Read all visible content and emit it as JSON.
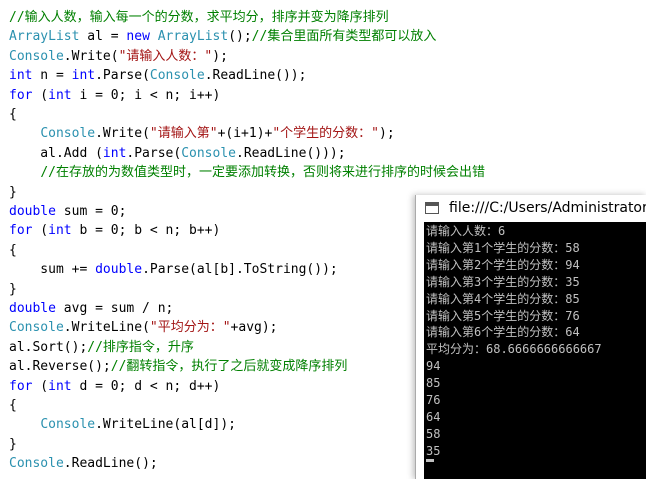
{
  "editor": {
    "lines": [
      [
        {
          "t": "cmt",
          "s": "//输入人数，输入每一个的分数，求平均分，排序并变为降序排列"
        }
      ],
      [
        {
          "t": "type",
          "s": "ArrayList"
        },
        {
          "t": "txt",
          "s": " al = "
        },
        {
          "t": "kw",
          "s": "new"
        },
        {
          "t": "txt",
          "s": " "
        },
        {
          "t": "type",
          "s": "ArrayList"
        },
        {
          "t": "txt",
          "s": "();"
        },
        {
          "t": "cmt",
          "s": "//集合里面所有类型都可以放入"
        }
      ],
      [
        {
          "t": "type",
          "s": "Console"
        },
        {
          "t": "txt",
          "s": ".Write("
        },
        {
          "t": "str",
          "s": "\"请输入人数：\""
        },
        {
          "t": "txt",
          "s": ");"
        }
      ],
      [
        {
          "t": "kw",
          "s": "int"
        },
        {
          "t": "txt",
          "s": " n = "
        },
        {
          "t": "kw",
          "s": "int"
        },
        {
          "t": "txt",
          "s": ".Parse("
        },
        {
          "t": "type",
          "s": "Console"
        },
        {
          "t": "txt",
          "s": ".ReadLine());"
        }
      ],
      [
        {
          "t": "kw",
          "s": "for"
        },
        {
          "t": "txt",
          "s": " ("
        },
        {
          "t": "kw",
          "s": "int"
        },
        {
          "t": "txt",
          "s": " i = 0; i < n; i++)"
        }
      ],
      [
        {
          "t": "txt",
          "s": "{"
        }
      ],
      [
        {
          "t": "txt",
          "s": "    "
        },
        {
          "t": "type",
          "s": "Console"
        },
        {
          "t": "txt",
          "s": ".Write("
        },
        {
          "t": "str",
          "s": "\"请输入第\""
        },
        {
          "t": "txt",
          "s": "+(i+1)+"
        },
        {
          "t": "str",
          "s": "\"个学生的分数：\""
        },
        {
          "t": "txt",
          "s": ");"
        }
      ],
      [
        {
          "t": "txt",
          "s": "    al.Add ("
        },
        {
          "t": "kw",
          "s": "int"
        },
        {
          "t": "txt",
          "s": ".Parse("
        },
        {
          "t": "type",
          "s": "Console"
        },
        {
          "t": "txt",
          "s": ".ReadLine()));"
        }
      ],
      [
        {
          "t": "txt",
          "s": "    "
        },
        {
          "t": "cmt",
          "s": "//在存放的为数值类型时，一定要添加转换，否则将来进行排序的时候会出错"
        }
      ],
      [
        {
          "t": "txt",
          "s": "}"
        }
      ],
      [
        {
          "t": "kw",
          "s": "double"
        },
        {
          "t": "txt",
          "s": " sum = 0;"
        }
      ],
      [
        {
          "t": "kw",
          "s": "for"
        },
        {
          "t": "txt",
          "s": " ("
        },
        {
          "t": "kw",
          "s": "int"
        },
        {
          "t": "txt",
          "s": " b = 0; b < n; b++)"
        }
      ],
      [
        {
          "t": "txt",
          "s": "{"
        }
      ],
      [
        {
          "t": "txt",
          "s": "    sum += "
        },
        {
          "t": "kw",
          "s": "double"
        },
        {
          "t": "txt",
          "s": ".Parse(al[b].ToString());"
        }
      ],
      [
        {
          "t": "txt",
          "s": "}"
        }
      ],
      [
        {
          "t": "kw",
          "s": "double"
        },
        {
          "t": "txt",
          "s": " avg = sum / n;"
        }
      ],
      [
        {
          "t": "type",
          "s": "Console"
        },
        {
          "t": "txt",
          "s": ".WriteLine("
        },
        {
          "t": "str",
          "s": "\"平均分为：\""
        },
        {
          "t": "txt",
          "s": "+avg);"
        }
      ],
      [
        {
          "t": "txt",
          "s": "al.Sort();"
        },
        {
          "t": "cmt",
          "s": "//排序指令，升序"
        }
      ],
      [
        {
          "t": "txt",
          "s": "al.Reverse();"
        },
        {
          "t": "cmt",
          "s": "//翻转指令，执行了之后就变成降序排列"
        }
      ],
      [
        {
          "t": "kw",
          "s": "for"
        },
        {
          "t": "txt",
          "s": " ("
        },
        {
          "t": "kw",
          "s": "int"
        },
        {
          "t": "txt",
          "s": " d = 0; d < n; d++)"
        }
      ],
      [
        {
          "t": "txt",
          "s": "{"
        }
      ],
      [
        {
          "t": "txt",
          "s": "    "
        },
        {
          "t": "type",
          "s": "Console"
        },
        {
          "t": "txt",
          "s": ".WriteLine(al[d]);"
        }
      ],
      [
        {
          "t": "txt",
          "s": "}"
        }
      ],
      [
        {
          "t": "type",
          "s": "Console"
        },
        {
          "t": "txt",
          "s": ".ReadLine();"
        }
      ]
    ]
  },
  "console": {
    "title": "file:///C:/Users/Administrator",
    "lines": [
      "请输入人数：6",
      "请输入第1个学生的分数：58",
      "请输入第2个学生的分数：94",
      "请输入第3个学生的分数：35",
      "请输入第4个学生的分数：85",
      "请输入第5个学生的分数：76",
      "请输入第6个学生的分数：64",
      "平均分为：68.6666666666667",
      "94",
      "85",
      "76",
      "64",
      "58",
      "35"
    ]
  },
  "colors": {
    "keyword": "#0000ff",
    "type": "#2b91af",
    "string": "#a31515",
    "comment": "#008000",
    "console_bg": "#000000",
    "console_text": "#c0c0c0"
  },
  "icons": {
    "console_app_icon": "console-window-icon"
  }
}
